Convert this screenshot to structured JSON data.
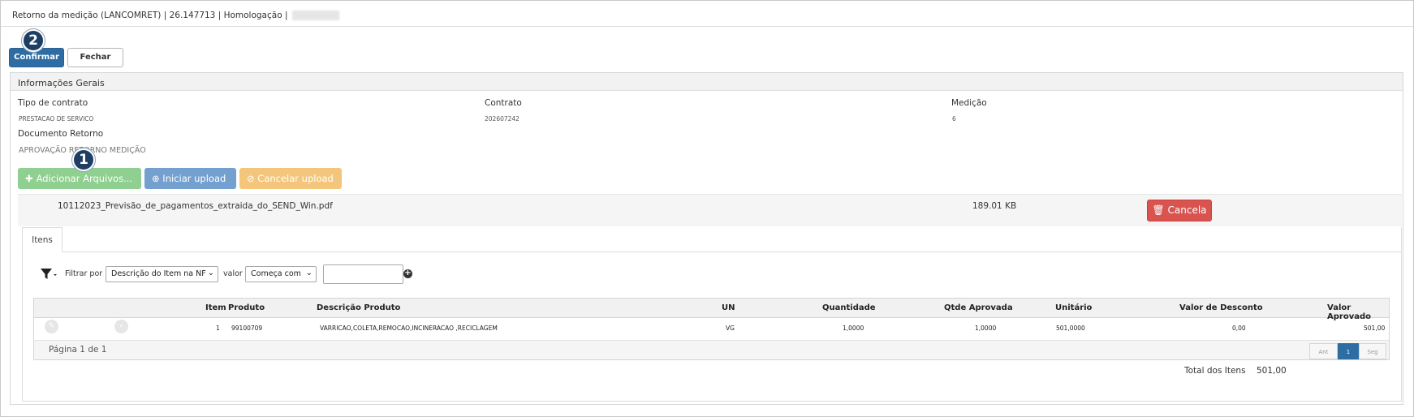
{
  "window": {
    "title": "Retorno da medição (LANCOMRET) | 26.147713 | Homologação |"
  },
  "toolbar": {
    "confirm_label": "Confirmar",
    "close_label": "Fechar"
  },
  "annotations": {
    "step1": "1",
    "step2": "2"
  },
  "general_info": {
    "header": "Informações Gerais",
    "contract_type_label": "Tipo de contrato",
    "contract_type_value": "PRESTACAO DE SERVICO",
    "contract_label": "Contrato",
    "contract_value": "202607242",
    "measurement_label": "Medição",
    "measurement_value": "6",
    "return_doc_label": "Documento Retorno",
    "return_doc_value": "APROVAÇÃO RETORNO MEDIÇÃO"
  },
  "upload": {
    "add_label": "Adicionar Arquivos...",
    "start_label": "Iniciar upload",
    "cancel_label": "Cancelar upload",
    "file_name": "10112023_Previsão_de_pagamentos_extraida_do_SEND_Win.pdf",
    "file_size": "189.01 KB",
    "file_cancel_label": "Cancela"
  },
  "tabs": [
    {
      "label": "Itens"
    }
  ],
  "filter": {
    "filter_by_label": "Filtrar por",
    "field_selected": "Descrição do Item na NF",
    "value_label": "valor",
    "operator_selected": "Começa com",
    "value_input": ""
  },
  "items_table": {
    "columns": [
      "Item",
      "Produto",
      "Descrição Produto",
      "UN",
      "Quantidade",
      "Qtde Aprovada",
      "Unitário",
      "Valor de Desconto",
      "Valor Aprovado"
    ],
    "rows": [
      {
        "item": "1",
        "produto": "99100709",
        "descricao": "VARRICAO,COLETA,REMOCAO,INCINERACAO ,RECICLAGEM",
        "un": "VG",
        "quantidade": "1,0000",
        "qtde_aprovada": "1,0000",
        "unitario": "501,0000",
        "valor_desconto": "0,00",
        "valor_aprovado": "501,00"
      }
    ],
    "page_info": "Página 1 de 1",
    "pager": {
      "prev": "Ant",
      "current": "1",
      "next": "Seg"
    },
    "total_label": "Total dos Itens",
    "total_value": "501,00"
  },
  "colors": {
    "primary": "#2e6da4",
    "success": "#8fcf8f",
    "info": "#74a0cf",
    "warning": "#f4c67b",
    "danger": "#d9534f",
    "badge": "#1f3e63"
  }
}
